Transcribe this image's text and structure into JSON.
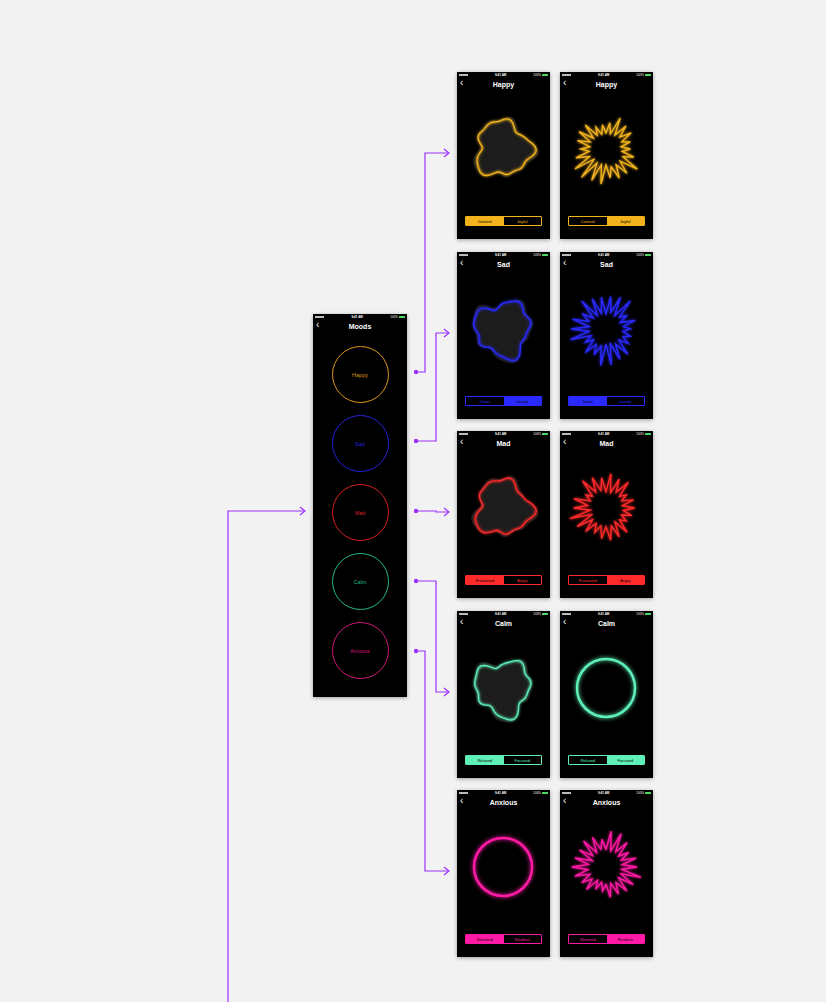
{
  "moods_screen": {
    "title": "Moods",
    "back": "‹",
    "time": "9:41 AM",
    "battery": "100%",
    "moods": [
      {
        "label": "Happy",
        "color": "#d9951c"
      },
      {
        "label": "Sad",
        "color": "#2424d8"
      },
      {
        "label": "Mad",
        "color": "#d82020"
      },
      {
        "label": "Calm",
        "color": "#22b882"
      },
      {
        "label": "Anxious",
        "color": "#d0187a"
      }
    ]
  },
  "detail_rows": [
    {
      "title": "Happy",
      "color": "#f2b31e",
      "screens": [
        {
          "kind": "blob",
          "segments": [
            {
              "label": "Content",
              "selected": true
            },
            {
              "label": "Joyful",
              "selected": false
            }
          ]
        },
        {
          "kind": "spiky",
          "segments": [
            {
              "label": "Content",
              "selected": false
            },
            {
              "label": "Joyful",
              "selected": true
            }
          ]
        }
      ]
    },
    {
      "title": "Sad",
      "color": "#2a2aff",
      "screens": [
        {
          "kind": "blob",
          "segments": [
            {
              "label": "Down",
              "selected": false
            },
            {
              "label": "Lonely",
              "selected": true
            }
          ]
        },
        {
          "kind": "spiky",
          "segments": [
            {
              "label": "Down",
              "selected": true
            },
            {
              "label": "Lonely",
              "selected": false
            }
          ]
        }
      ]
    },
    {
      "title": "Mad",
      "color": "#ff2a2a",
      "screens": [
        {
          "kind": "blob",
          "segments": [
            {
              "label": "Frustrated",
              "selected": true
            },
            {
              "label": "Angry",
              "selected": false
            }
          ]
        },
        {
          "kind": "spiky",
          "segments": [
            {
              "label": "Frustrated",
              "selected": false
            },
            {
              "label": "Angry",
              "selected": true
            }
          ]
        }
      ]
    },
    {
      "title": "Calm",
      "color": "#5ef0b8",
      "screens": [
        {
          "kind": "blob",
          "segments": [
            {
              "label": "Relaxed",
              "selected": true
            },
            {
              "label": "Focused",
              "selected": false
            }
          ]
        },
        {
          "kind": "ring",
          "segments": [
            {
              "label": "Relaxed",
              "selected": false
            },
            {
              "label": "Focused",
              "selected": true
            }
          ]
        }
      ]
    },
    {
      "title": "Anxious",
      "color": "#ff1aa6",
      "screens": [
        {
          "kind": "ring",
          "segments": [
            {
              "label": "Stressed",
              "selected": true
            },
            {
              "label": "Restless",
              "selected": false
            }
          ]
        },
        {
          "kind": "spiky",
          "segments": [
            {
              "label": "Stressed",
              "selected": false
            },
            {
              "label": "Restless",
              "selected": true
            }
          ]
        }
      ]
    }
  ]
}
